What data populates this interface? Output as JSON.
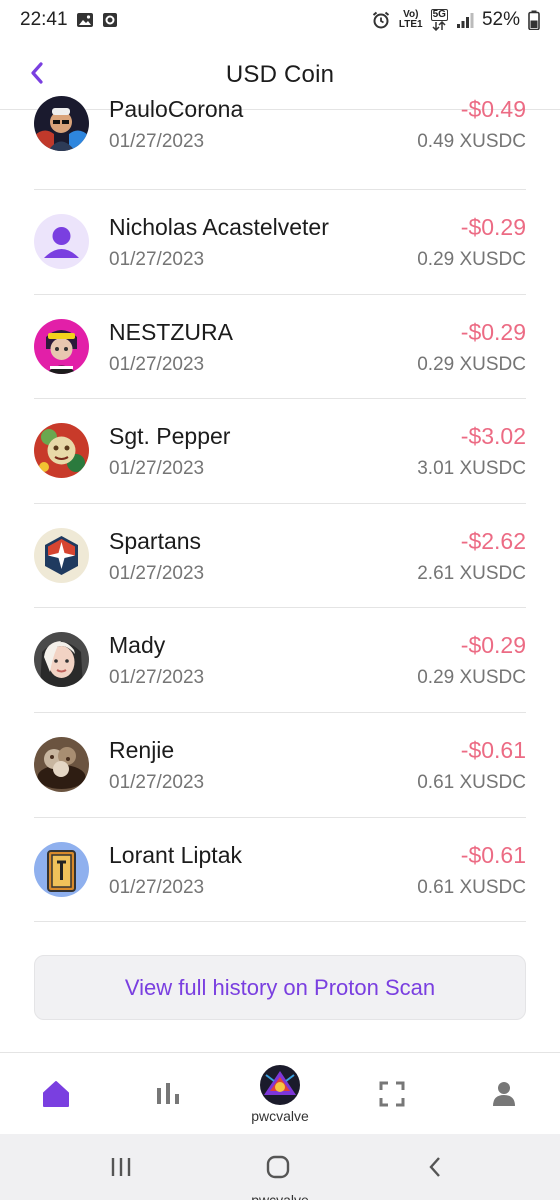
{
  "status_bar": {
    "time": "22:41",
    "battery": "52%",
    "network_top": "Vo)",
    "network_bottom": "LTE1",
    "network_5g": "5G"
  },
  "header": {
    "title": "USD Coin"
  },
  "transactions": [
    {
      "name": "PauloCorona",
      "date": "01/27/2023",
      "amount": "-$0.49",
      "token_amount": "0.49 XUSDC"
    },
    {
      "name": "Nicholas Acastelveter",
      "date": "01/27/2023",
      "amount": "-$0.29",
      "token_amount": "0.29 XUSDC"
    },
    {
      "name": "NESTZURA",
      "date": "01/27/2023",
      "amount": "-$0.29",
      "token_amount": "0.29 XUSDC"
    },
    {
      "name": "Sgt. Pepper",
      "date": "01/27/2023",
      "amount": "-$3.02",
      "token_amount": "3.01 XUSDC"
    },
    {
      "name": "Spartans",
      "date": "01/27/2023",
      "amount": "-$2.62",
      "token_amount": "2.61 XUSDC"
    },
    {
      "name": "Mady",
      "date": "01/27/2023",
      "amount": "-$0.29",
      "token_amount": "0.29 XUSDC"
    },
    {
      "name": "Renjie",
      "date": "01/27/2023",
      "amount": "-$0.61",
      "token_amount": "0.61 XUSDC"
    },
    {
      "name": "Lorant Liptak",
      "date": "01/27/2023",
      "amount": "-$0.61",
      "token_amount": "0.61 XUSDC"
    }
  ],
  "history_button": {
    "label": "View full history on Proton Scan"
  },
  "bottom_nav": {
    "items": [
      {
        "icon": "home-icon",
        "active": true
      },
      {
        "icon": "bar-chart-icon",
        "active": false
      },
      {
        "icon": "profile-avatar",
        "label": "pwcvalve",
        "active": false
      },
      {
        "icon": "scan-icon",
        "active": false
      },
      {
        "icon": "user-icon",
        "active": false
      }
    ]
  },
  "system_nav": {
    "label": "pwcvalve"
  },
  "colors": {
    "accent": "#7a3fe0",
    "negative_amount": "#ec6b84",
    "secondary_text": "#757575"
  }
}
